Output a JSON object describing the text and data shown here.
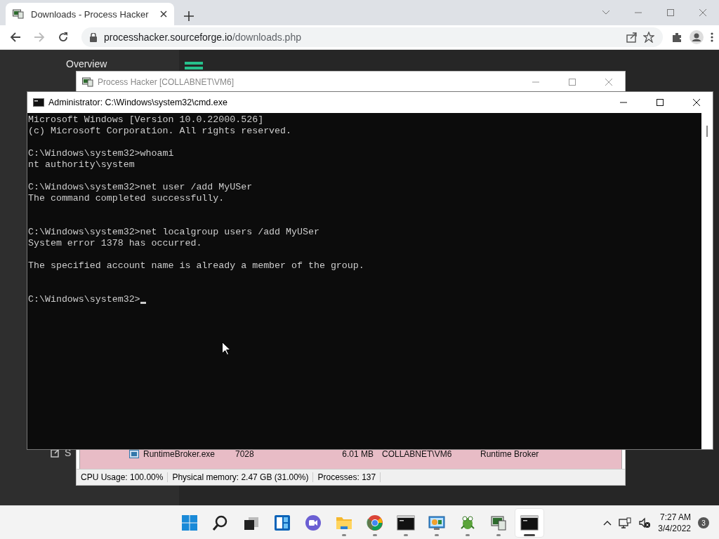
{
  "browser": {
    "tab": {
      "title": "Downloads - Process Hacker",
      "selected": true
    },
    "address": {
      "host": "processhacker.sourceforge.io",
      "path": "/downloads.php"
    },
    "nav": {
      "forward_disabled": true
    }
  },
  "page": {
    "sidebar_label": "Overview",
    "sidebar_fragment": "S"
  },
  "process_hacker": {
    "title": "Process Hacker [COLLABNET\\VM6]",
    "active": false,
    "rows": [
      {
        "name": "RuntimeBroker.exe",
        "pid": "7028",
        "memory": "6.01 MB",
        "user": "COLLABNET\\VM6",
        "description": "Runtime Broker"
      }
    ],
    "status_bar": [
      "CPU Usage: 100.00%",
      "Physical memory: 2.47 GB (31.00%)",
      "Processes: 137"
    ]
  },
  "cmd": {
    "title": "Administrator: C:\\Windows\\system32\\cmd.exe",
    "active": true,
    "blocks": [
      {
        "lines": [
          "Microsoft Windows [Version 10.0.22000.526]",
          "(c) Microsoft Corporation. All rights reserved."
        ],
        "kind": "single"
      },
      {
        "lines": [
          "C:\\Windows\\system32>whoami",
          "nt authority\\system"
        ],
        "kind": "single"
      },
      {
        "lines": [
          "C:\\Windows\\system32>net user /add MyUSer",
          "The command completed successfully."
        ],
        "kind": "double"
      },
      {
        "lines": [
          "C:\\Windows\\system32>net localgroup users /add MyUSer",
          "System error 1378 has occurred."
        ],
        "kind": "single"
      },
      {
        "lines": [
          "The specified account name is already a member of the group."
        ],
        "kind": "double"
      },
      {
        "lines": [
          "C:\\Windows\\system32>"
        ],
        "kind": "last",
        "cursor": true
      }
    ]
  },
  "taskbar": {
    "apps": [
      {
        "kind": "start",
        "running": false,
        "selected": false
      },
      {
        "kind": "search",
        "running": false,
        "selected": false
      },
      {
        "kind": "taskview",
        "running": false,
        "selected": false
      },
      {
        "kind": "widgets",
        "running": false,
        "selected": false
      },
      {
        "kind": "chat",
        "running": false,
        "selected": false
      },
      {
        "kind": "folder",
        "running": true,
        "selected": false
      },
      {
        "kind": "browser",
        "running": true,
        "selected": false
      },
      {
        "kind": "terminal",
        "running": true,
        "selected": false
      },
      {
        "kind": "panel",
        "running": true,
        "selected": false
      },
      {
        "kind": "gecko",
        "running": true,
        "selected": false
      },
      {
        "kind": "monitor",
        "running": true,
        "selected": false
      },
      {
        "kind": "terminal",
        "running": true,
        "selected": true
      }
    ],
    "time": "7:27 AM",
    "date": "3/4/2022",
    "notifications": "3"
  }
}
